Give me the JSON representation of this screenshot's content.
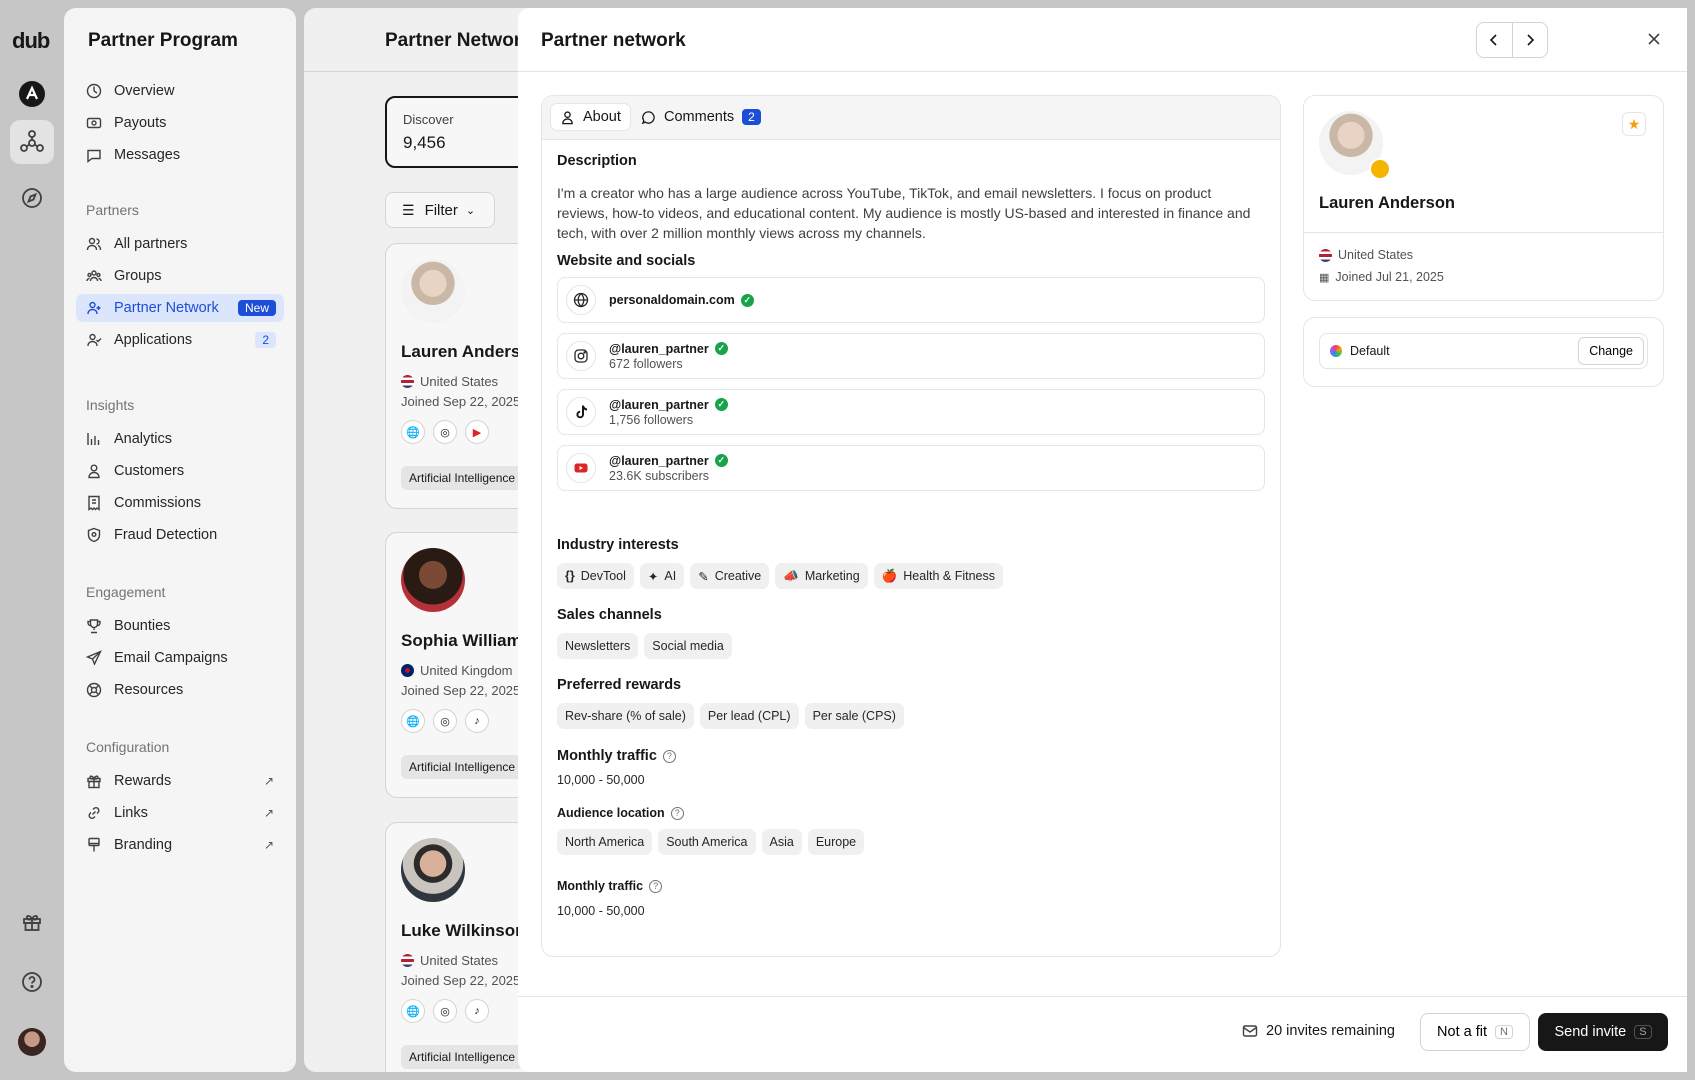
{
  "app": {
    "logo": "dub"
  },
  "sidebar": {
    "title": "Partner Program",
    "top_items": [
      {
        "label": "Overview",
        "icon": "overview-icon"
      },
      {
        "label": "Payouts",
        "icon": "payouts-icon"
      },
      {
        "label": "Messages",
        "icon": "messages-icon"
      }
    ],
    "sections": {
      "partners": "Partners",
      "insights": "Insights",
      "engagement": "Engagement",
      "configuration": "Configuration"
    },
    "partners_items": [
      {
        "label": "All partners"
      },
      {
        "label": "Groups"
      },
      {
        "label": "Partner Network",
        "badge": "New",
        "active": true
      },
      {
        "label": "Applications",
        "badge": "2"
      }
    ],
    "insights_items": [
      {
        "label": "Analytics"
      },
      {
        "label": "Customers"
      },
      {
        "label": "Commissions"
      },
      {
        "label": "Fraud Detection"
      }
    ],
    "engagement_items": [
      {
        "label": "Bounties"
      },
      {
        "label": "Email Campaigns"
      },
      {
        "label": "Resources"
      }
    ],
    "configuration_items": [
      {
        "label": "Rewards",
        "external": "↗"
      },
      {
        "label": "Links",
        "external": "↗"
      },
      {
        "label": "Branding",
        "external": "↗"
      }
    ]
  },
  "background_page": {
    "title": "Partner Network",
    "discover": {
      "label": "Discover",
      "value": "9,456"
    },
    "filter_label": "Filter",
    "cards": [
      {
        "name": "Lauren Anderson",
        "country": "United States",
        "joined": "Joined Sep 22, 2025",
        "tag": "Artificial Intelligence"
      },
      {
        "name": "Sophia Williams",
        "country": "United Kingdom",
        "joined": "Joined Sep 22, 2025",
        "tag": "Artificial Intelligence"
      },
      {
        "name": "Luke Wilkinson",
        "country": "United States",
        "joined": "Joined Sep 22, 2025",
        "tag": "Artificial Intelligence"
      }
    ]
  },
  "modal": {
    "title": "Partner network",
    "tabs": {
      "about": "About",
      "comments": "Comments",
      "comments_count": "2"
    },
    "description": {
      "heading": "Description",
      "text": "I'm a creator who has a large audience across YouTube, TikTok, and email newsletters. I focus on product reviews, how-to videos, and educational content. My audience is mostly US-based and interested in finance and tech, with over 2 million monthly views across my channels."
    },
    "socials": {
      "heading": "Website and socials",
      "website": {
        "label": "personaldomain.com",
        "icon": "globe-icon"
      },
      "instagram": {
        "handle": "@lauren_partner",
        "stat": "672 followers",
        "icon": "instagram-icon"
      },
      "tiktok": {
        "handle": "@lauren_partner",
        "stat": "1,756 followers",
        "icon": "tiktok-icon"
      },
      "youtube": {
        "handle": "@lauren_partner",
        "stat": "23.6K subscribers",
        "icon": "youtube-icon"
      }
    },
    "industry": {
      "heading": "Industry interests",
      "items": [
        "DevTool",
        "AI",
        "Creative",
        "Marketing",
        "Health & Fitness"
      ]
    },
    "sales_channels": {
      "heading": "Sales channels",
      "items": [
        "Newsletters",
        "Social media"
      ]
    },
    "rewards": {
      "heading": "Preferred rewards",
      "items": [
        "Rev-share (% of sale)",
        "Per lead (CPL)",
        "Per sale (CPS)"
      ]
    },
    "monthly_traffic": {
      "heading": "Monthly traffic",
      "value": "10,000 - 50,000"
    },
    "audience_location": {
      "heading": "Audience location",
      "items": [
        "North America",
        "South America",
        "Asia",
        "Europe"
      ]
    },
    "monthly_traffic_2": {
      "heading": "Monthly traffic",
      "value": "10,000 - 50,000"
    },
    "profile": {
      "name": "Lauren Anderson",
      "country": "United States",
      "joined": "Joined Jul 21, 2025",
      "group": "Default",
      "change_label": "Change"
    },
    "footer": {
      "invites": "20 invites remaining",
      "not_fit": "Not a fit",
      "not_fit_key": "N",
      "send": "Send invite",
      "send_key": "S"
    }
  },
  "colors": {
    "accent": "#1d4ed8",
    "verified": "#16a34a",
    "primary_button": "#171717",
    "star": "#f59e0b"
  }
}
